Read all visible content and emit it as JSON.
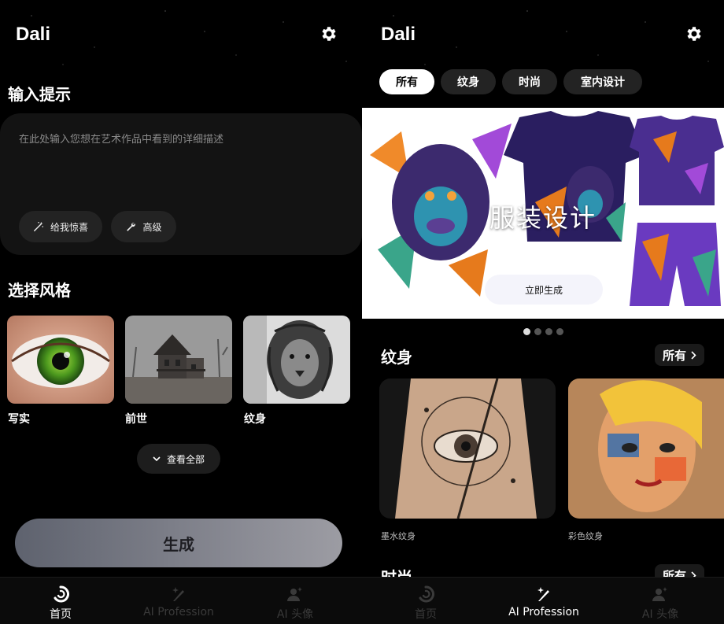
{
  "left": {
    "app_title": "Dali",
    "prompt_section_title": "输入提示",
    "prompt_placeholder": "在此处输入您想在艺术作品中看到的详细描述",
    "surprise_label": "给我惊喜",
    "advanced_label": "高级",
    "style_section_title": "选择风格",
    "styles": [
      {
        "label": "写实",
        "icon": "eye-image"
      },
      {
        "label": "前世",
        "icon": "haunted-house-image"
      },
      {
        "label": "纹身",
        "icon": "lion-tattoo-image"
      }
    ],
    "view_all_label": "查看全部",
    "generate_label": "生成"
  },
  "right": {
    "app_title": "Dali",
    "chips": [
      "所有",
      "纹身",
      "时尚",
      "室内设计"
    ],
    "active_chip": "所有",
    "banner": {
      "title": "服装设计",
      "button_label": "立即生成",
      "slide_index": 1,
      "slide_count": 4
    },
    "tattoo_section": {
      "title": "纹身",
      "all_label": "所有",
      "cards": [
        {
          "label": "墨水纹身"
        },
        {
          "label": "彩色纹身"
        }
      ]
    },
    "fashion_section": {
      "title": "时尚",
      "all_label": "所有"
    }
  },
  "nav": {
    "items": [
      {
        "label": "首页",
        "icon": "dali-logo-icon"
      },
      {
        "label": "AI Profession",
        "icon": "sparkle-pen-icon"
      },
      {
        "label": "AI 头像",
        "icon": "avatar-icon"
      }
    ],
    "left_active": "首页",
    "right_active": "AI Profession"
  },
  "colors": {
    "background": "#000000",
    "surface": "#131313",
    "pill": "#232323",
    "nav_inactive": "#3a3a3a",
    "active_chip_bg": "#ffffff"
  }
}
